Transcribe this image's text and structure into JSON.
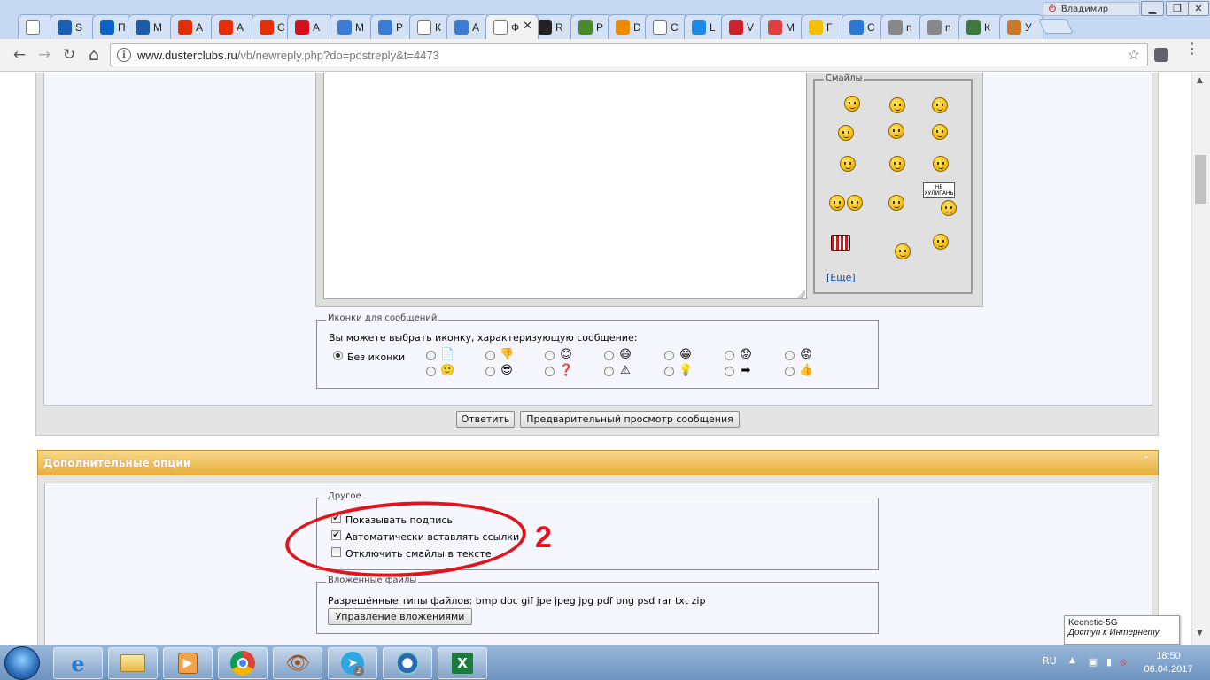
{
  "window": {
    "user": "Владимир",
    "min": "▁",
    "restore": "❐",
    "close": "✕"
  },
  "tabs": [
    {
      "label": "",
      "icon": "page-icon",
      "color": "#ffffff"
    },
    {
      "label": "S",
      "icon": "cloud-icon",
      "color": "#1a5fb4"
    },
    {
      "label": "П",
      "icon": "outlook-icon",
      "color": "#0a64c8"
    },
    {
      "label": "М",
      "icon": "book-icon",
      "color": "#1f5ca8"
    },
    {
      "label": "А",
      "icon": "aliexpress-icon",
      "color": "#e62e04"
    },
    {
      "label": "А",
      "icon": "aliexpress-icon",
      "color": "#e62e04"
    },
    {
      "label": "С",
      "icon": "aliexpress-icon",
      "color": "#e62e04"
    },
    {
      "label": "А",
      "icon": "acrobat-icon",
      "color": "#d4101a"
    },
    {
      "label": "М",
      "icon": "edit-icon",
      "color": "#3a7bd5"
    },
    {
      "label": "Р",
      "icon": "edit-icon",
      "color": "#3a7bd5"
    },
    {
      "label": "К",
      "icon": "page-icon",
      "color": "#ffffff"
    },
    {
      "label": "А",
      "icon": "edit-icon",
      "color": "#3a7bd5"
    },
    {
      "label": "Ф",
      "icon": "forum-icon",
      "color": "#ffffff",
      "active": true
    },
    {
      "label": "R",
      "icon": "steering-icon",
      "color": "#222222"
    },
    {
      "label": "Р",
      "icon": "beads-icon",
      "color": "#4a8a2a"
    },
    {
      "label": "D",
      "icon": "orange-icon",
      "color": "#f08a00"
    },
    {
      "label": "С",
      "icon": "page-icon",
      "color": "#ffffff"
    },
    {
      "label": "L",
      "icon": "diamond-icon",
      "color": "#1e88e5"
    },
    {
      "label": "V",
      "icon": "ring-icon",
      "color": "#d0202a"
    },
    {
      "label": "М",
      "icon": "dots-icon",
      "color": "#e04040"
    },
    {
      "label": "Г",
      "icon": "bee-icon",
      "color": "#f4c000"
    },
    {
      "label": "С",
      "icon": "roller-icon",
      "color": "#2a7ad4"
    },
    {
      "label": "n",
      "icon": "ie-icon",
      "color": "#888888"
    },
    {
      "label": "n",
      "icon": "ie-icon",
      "color": "#888888"
    },
    {
      "label": "К",
      "icon": "bug-icon",
      "color": "#3a7a3a"
    },
    {
      "label": "У",
      "icon": "figure-icon",
      "color": "#c87a2a"
    }
  ],
  "toolbar": {
    "back": "←",
    "forward": "→",
    "reload": "↻",
    "home": "⌂",
    "url_host": "www.dusterclubs.ru",
    "url_path": "/vb/newreply.php?do=postreply&t=4473",
    "info": "i",
    "star": "☆",
    "menu": "⋮"
  },
  "smilies": {
    "legend": "Смайлы",
    "sign_text": "НЕ ХУЛИГАНЬ",
    "more": "[Ещё]"
  },
  "post_icons": {
    "legend": "Иконки для сообщений",
    "prompt": "Вы можете выбрать иконку, характеризующую сообщение:",
    "none_label": "Без иконки",
    "icons_row1": [
      "📄",
      "👎",
      "😊",
      "😄",
      "😁",
      "😟",
      "😡"
    ],
    "icons_row2": [
      "🙂",
      "😎",
      "❓",
      "⚠",
      "💡",
      "➡",
      "👍"
    ]
  },
  "buttons": {
    "reply": "Ответить",
    "preview": "Предварительный просмотр сообщения",
    "manage_attachments": "Управление вложениями"
  },
  "additional": {
    "title": "Дополнительные опции",
    "collapse": "⌃"
  },
  "other": {
    "legend": "Другое",
    "show_signature": "Показывать подпись",
    "auto_links": "Автоматически вставлять ссылки",
    "disable_smilies": "Отключить смайлы в тексте",
    "show_signature_checked": true,
    "auto_links_checked": true,
    "disable_smilies_checked": false
  },
  "attachments": {
    "legend": "Вложенные файлы",
    "allowed_types": "Разрешённые типы файлов: bmp doc gif jpe jpeg jpg pdf png psd rar txt zip"
  },
  "annotation": {
    "number": "2",
    "color": "#e2141b"
  },
  "notification": {
    "title": "Keenetic-5G",
    "subtitle": "Доступ к Интернету"
  },
  "taskbar": {
    "items": [
      "ie-icon",
      "explorer-icon",
      "media-player-icon",
      "chrome-icon",
      "eye-icon",
      "telegram-icon",
      "network-icon",
      "excel-icon"
    ],
    "telegram_badge": "2",
    "lang": "RU",
    "time": "18:50",
    "date": "06.04.2017"
  }
}
